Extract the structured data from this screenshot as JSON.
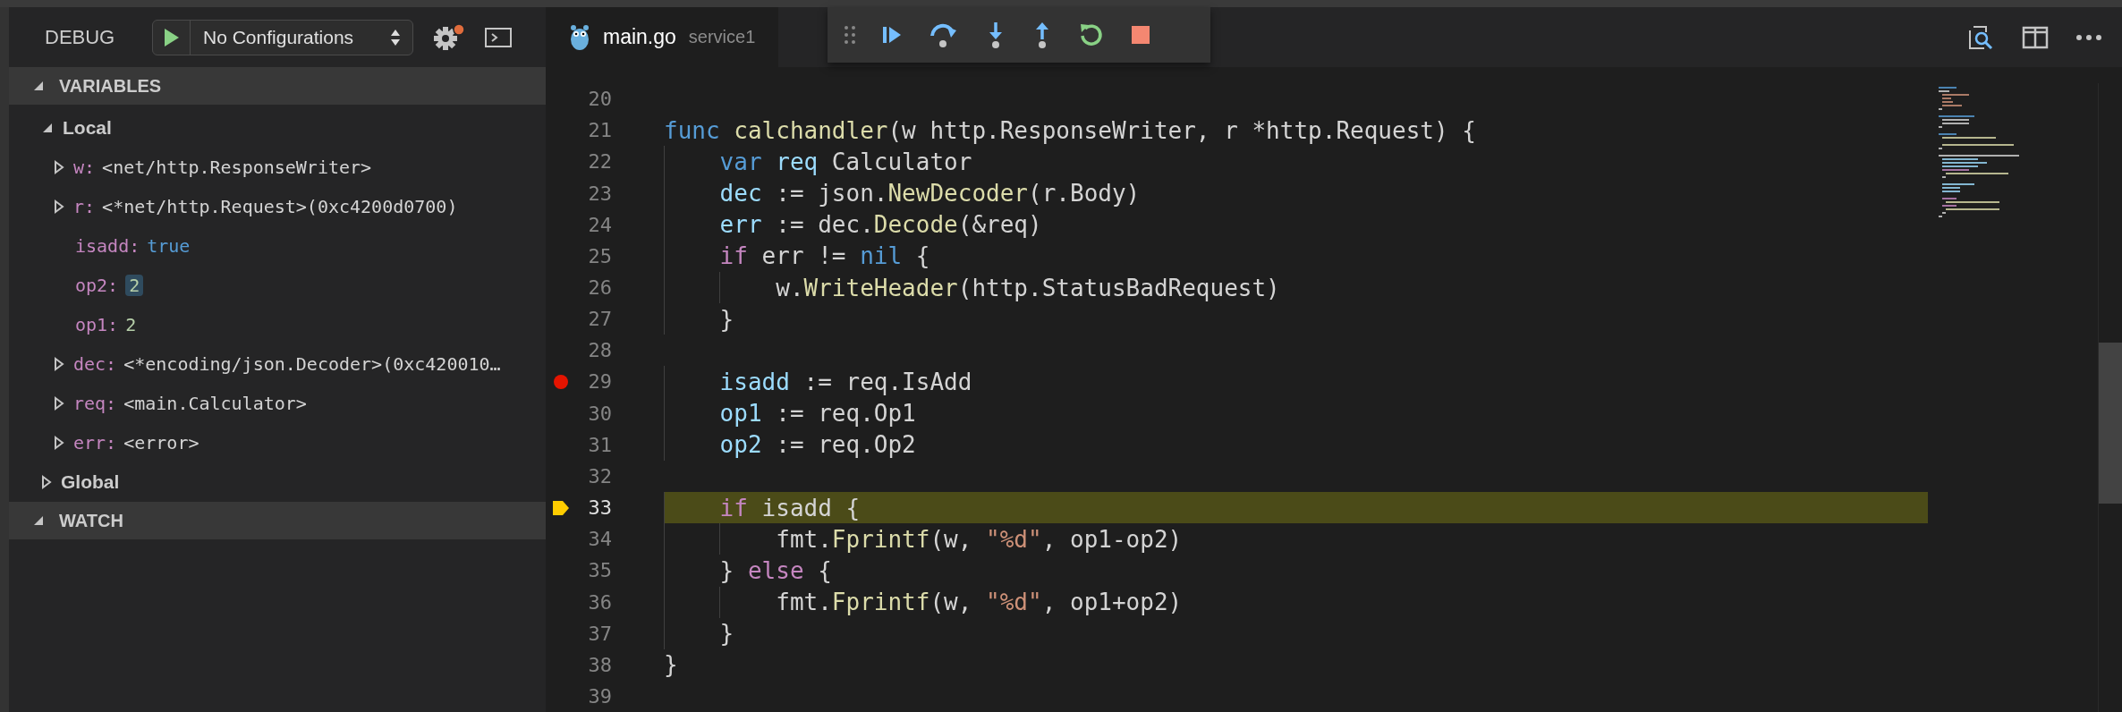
{
  "sidebar": {
    "title": "DEBUG",
    "configuration": {
      "value": "No Configurations"
    },
    "sections": [
      {
        "title": "VARIABLES",
        "expanded": true,
        "scopes": [
          {
            "name": "Local",
            "expanded": true,
            "children": [
              {
                "name": "w:",
                "value": "<net/http.ResponseWriter>",
                "color": "#d4d4d4",
                "kind": "expandable",
                "expanded": false,
                "changed": false
              },
              {
                "name": "r:",
                "value": "<*net/http.Request>(0xc4200d0700)",
                "color": "#d4d4d4",
                "kind": "expandable",
                "expanded": false,
                "changed": false
              },
              {
                "name": "isadd:",
                "value": "true",
                "color": "#569cd6",
                "kind": "leaf",
                "changed": false
              },
              {
                "name": "op2:",
                "value": "2",
                "color": "#b5cea8",
                "kind": "leaf",
                "changed": true
              },
              {
                "name": "op1:",
                "value": "2",
                "color": "#b5cea8",
                "kind": "leaf",
                "changed": false
              },
              {
                "name": "dec:",
                "value": "<*encoding/json.Decoder>(0xc420010…",
                "color": "#d4d4d4",
                "kind": "expandable",
                "expanded": false,
                "changed": false
              },
              {
                "name": "req:",
                "value": "<main.Calculator>",
                "color": "#d4d4d4",
                "kind": "expandable",
                "expanded": false,
                "changed": false
              },
              {
                "name": "err:",
                "value": "<error>",
                "color": "#d4d4d4",
                "kind": "expandable",
                "expanded": false,
                "changed": false
              }
            ]
          },
          {
            "name": "Global",
            "expanded": false
          }
        ]
      },
      {
        "title": "WATCH",
        "expanded": true
      }
    ]
  },
  "editor": {
    "tab": {
      "label": "main.go",
      "description": "service1",
      "selected": true
    },
    "lines": [
      {
        "number": "20",
        "breakpoint": false,
        "current": false
      },
      {
        "number": "21",
        "breakpoint": false,
        "current": false,
        "tokens": [
          {
            "text": "func ",
            "kind": "keyword"
          },
          {
            "text": "calchandler",
            "kind": "function"
          },
          {
            "text": "(w http.ResponseWriter, r *http.Request) {",
            "kind": "plain"
          }
        ]
      },
      {
        "number": "22",
        "breakpoint": false,
        "current": false,
        "tokens": [
          {
            "text": "    var ",
            "kind": "keyword"
          },
          {
            "text": "req",
            "kind": "variable"
          },
          {
            "text": " Calculator",
            "kind": "plain"
          }
        ]
      },
      {
        "number": "23",
        "breakpoint": false,
        "current": false,
        "tokens": [
          {
            "text": "    dec",
            "kind": "variable"
          },
          {
            "text": " := json.",
            "kind": "plain"
          },
          {
            "text": "NewDecoder",
            "kind": "function"
          },
          {
            "text": "(r.Body)",
            "kind": "plain"
          }
        ]
      },
      {
        "number": "24",
        "breakpoint": false,
        "current": false,
        "tokens": [
          {
            "text": "    err",
            "kind": "variable"
          },
          {
            "text": " := dec.",
            "kind": "plain"
          },
          {
            "text": "Decode",
            "kind": "function"
          },
          {
            "text": "(&req)",
            "kind": "plain"
          }
        ]
      },
      {
        "number": "25",
        "breakpoint": false,
        "current": false,
        "tokens": [
          {
            "text": "    if",
            "kind": "control"
          },
          {
            "text": " err != ",
            "kind": "plain"
          },
          {
            "text": "nil",
            "kind": "keyword"
          },
          {
            "text": " {",
            "kind": "plain"
          }
        ]
      },
      {
        "number": "26",
        "breakpoint": false,
        "current": false,
        "tokens": [
          {
            "text": "        w.",
            "kind": "plain"
          },
          {
            "text": "WriteHeader",
            "kind": "function"
          },
          {
            "text": "(http.StatusBadRequest)",
            "kind": "plain"
          }
        ]
      },
      {
        "number": "27",
        "breakpoint": false,
        "current": false,
        "tokens": [
          {
            "text": "    }",
            "kind": "plain"
          }
        ]
      },
      {
        "number": "28",
        "breakpoint": false,
        "current": false
      },
      {
        "number": "29",
        "breakpoint": true,
        "current": false,
        "tokens": [
          {
            "text": "    isadd",
            "kind": "variable"
          },
          {
            "text": " := req.IsAdd",
            "kind": "plain"
          }
        ]
      },
      {
        "number": "30",
        "breakpoint": false,
        "current": false,
        "tokens": [
          {
            "text": "    op1",
            "kind": "variable"
          },
          {
            "text": " := req.Op1",
            "kind": "plain"
          }
        ]
      },
      {
        "number": "31",
        "breakpoint": false,
        "current": false,
        "tokens": [
          {
            "text": "    op2",
            "kind": "variable"
          },
          {
            "text": " := req.Op2",
            "kind": "plain"
          }
        ]
      },
      {
        "number": "32",
        "breakpoint": false,
        "current": false
      },
      {
        "number": "33",
        "breakpoint": false,
        "current": true,
        "tokens": [
          {
            "text": "    if",
            "kind": "control"
          },
          {
            "text": " isadd {",
            "kind": "plain"
          }
        ]
      },
      {
        "number": "34",
        "breakpoint": false,
        "current": false,
        "tokens": [
          {
            "text": "        fmt.",
            "kind": "plain"
          },
          {
            "text": "Fprintf",
            "kind": "function"
          },
          {
            "text": "(w, ",
            "kind": "plain"
          },
          {
            "text": "\"%d\"",
            "kind": "string"
          },
          {
            "text": ", op1-op2)",
            "kind": "plain"
          }
        ]
      },
      {
        "number": "35",
        "breakpoint": false,
        "current": false,
        "tokens": [
          {
            "text": "    } ",
            "kind": "plain"
          },
          {
            "text": "else",
            "kind": "control"
          },
          {
            "text": " {",
            "kind": "plain"
          }
        ]
      },
      {
        "number": "36",
        "breakpoint": false,
        "current": false,
        "tokens": [
          {
            "text": "        fmt.",
            "kind": "plain"
          },
          {
            "text": "Fprintf",
            "kind": "function"
          },
          {
            "text": "(w, ",
            "kind": "plain"
          },
          {
            "text": "\"%d\"",
            "kind": "string"
          },
          {
            "text": ", op1+op2)",
            "kind": "plain"
          }
        ]
      },
      {
        "number": "37",
        "breakpoint": false,
        "current": false,
        "tokens": [
          {
            "text": "    }",
            "kind": "plain"
          }
        ]
      },
      {
        "number": "38",
        "breakpoint": false,
        "current": false,
        "tokens": [
          {
            "text": "}",
            "kind": "plain"
          }
        ]
      },
      {
        "number": "39",
        "breakpoint": false,
        "current": false
      }
    ]
  }
}
